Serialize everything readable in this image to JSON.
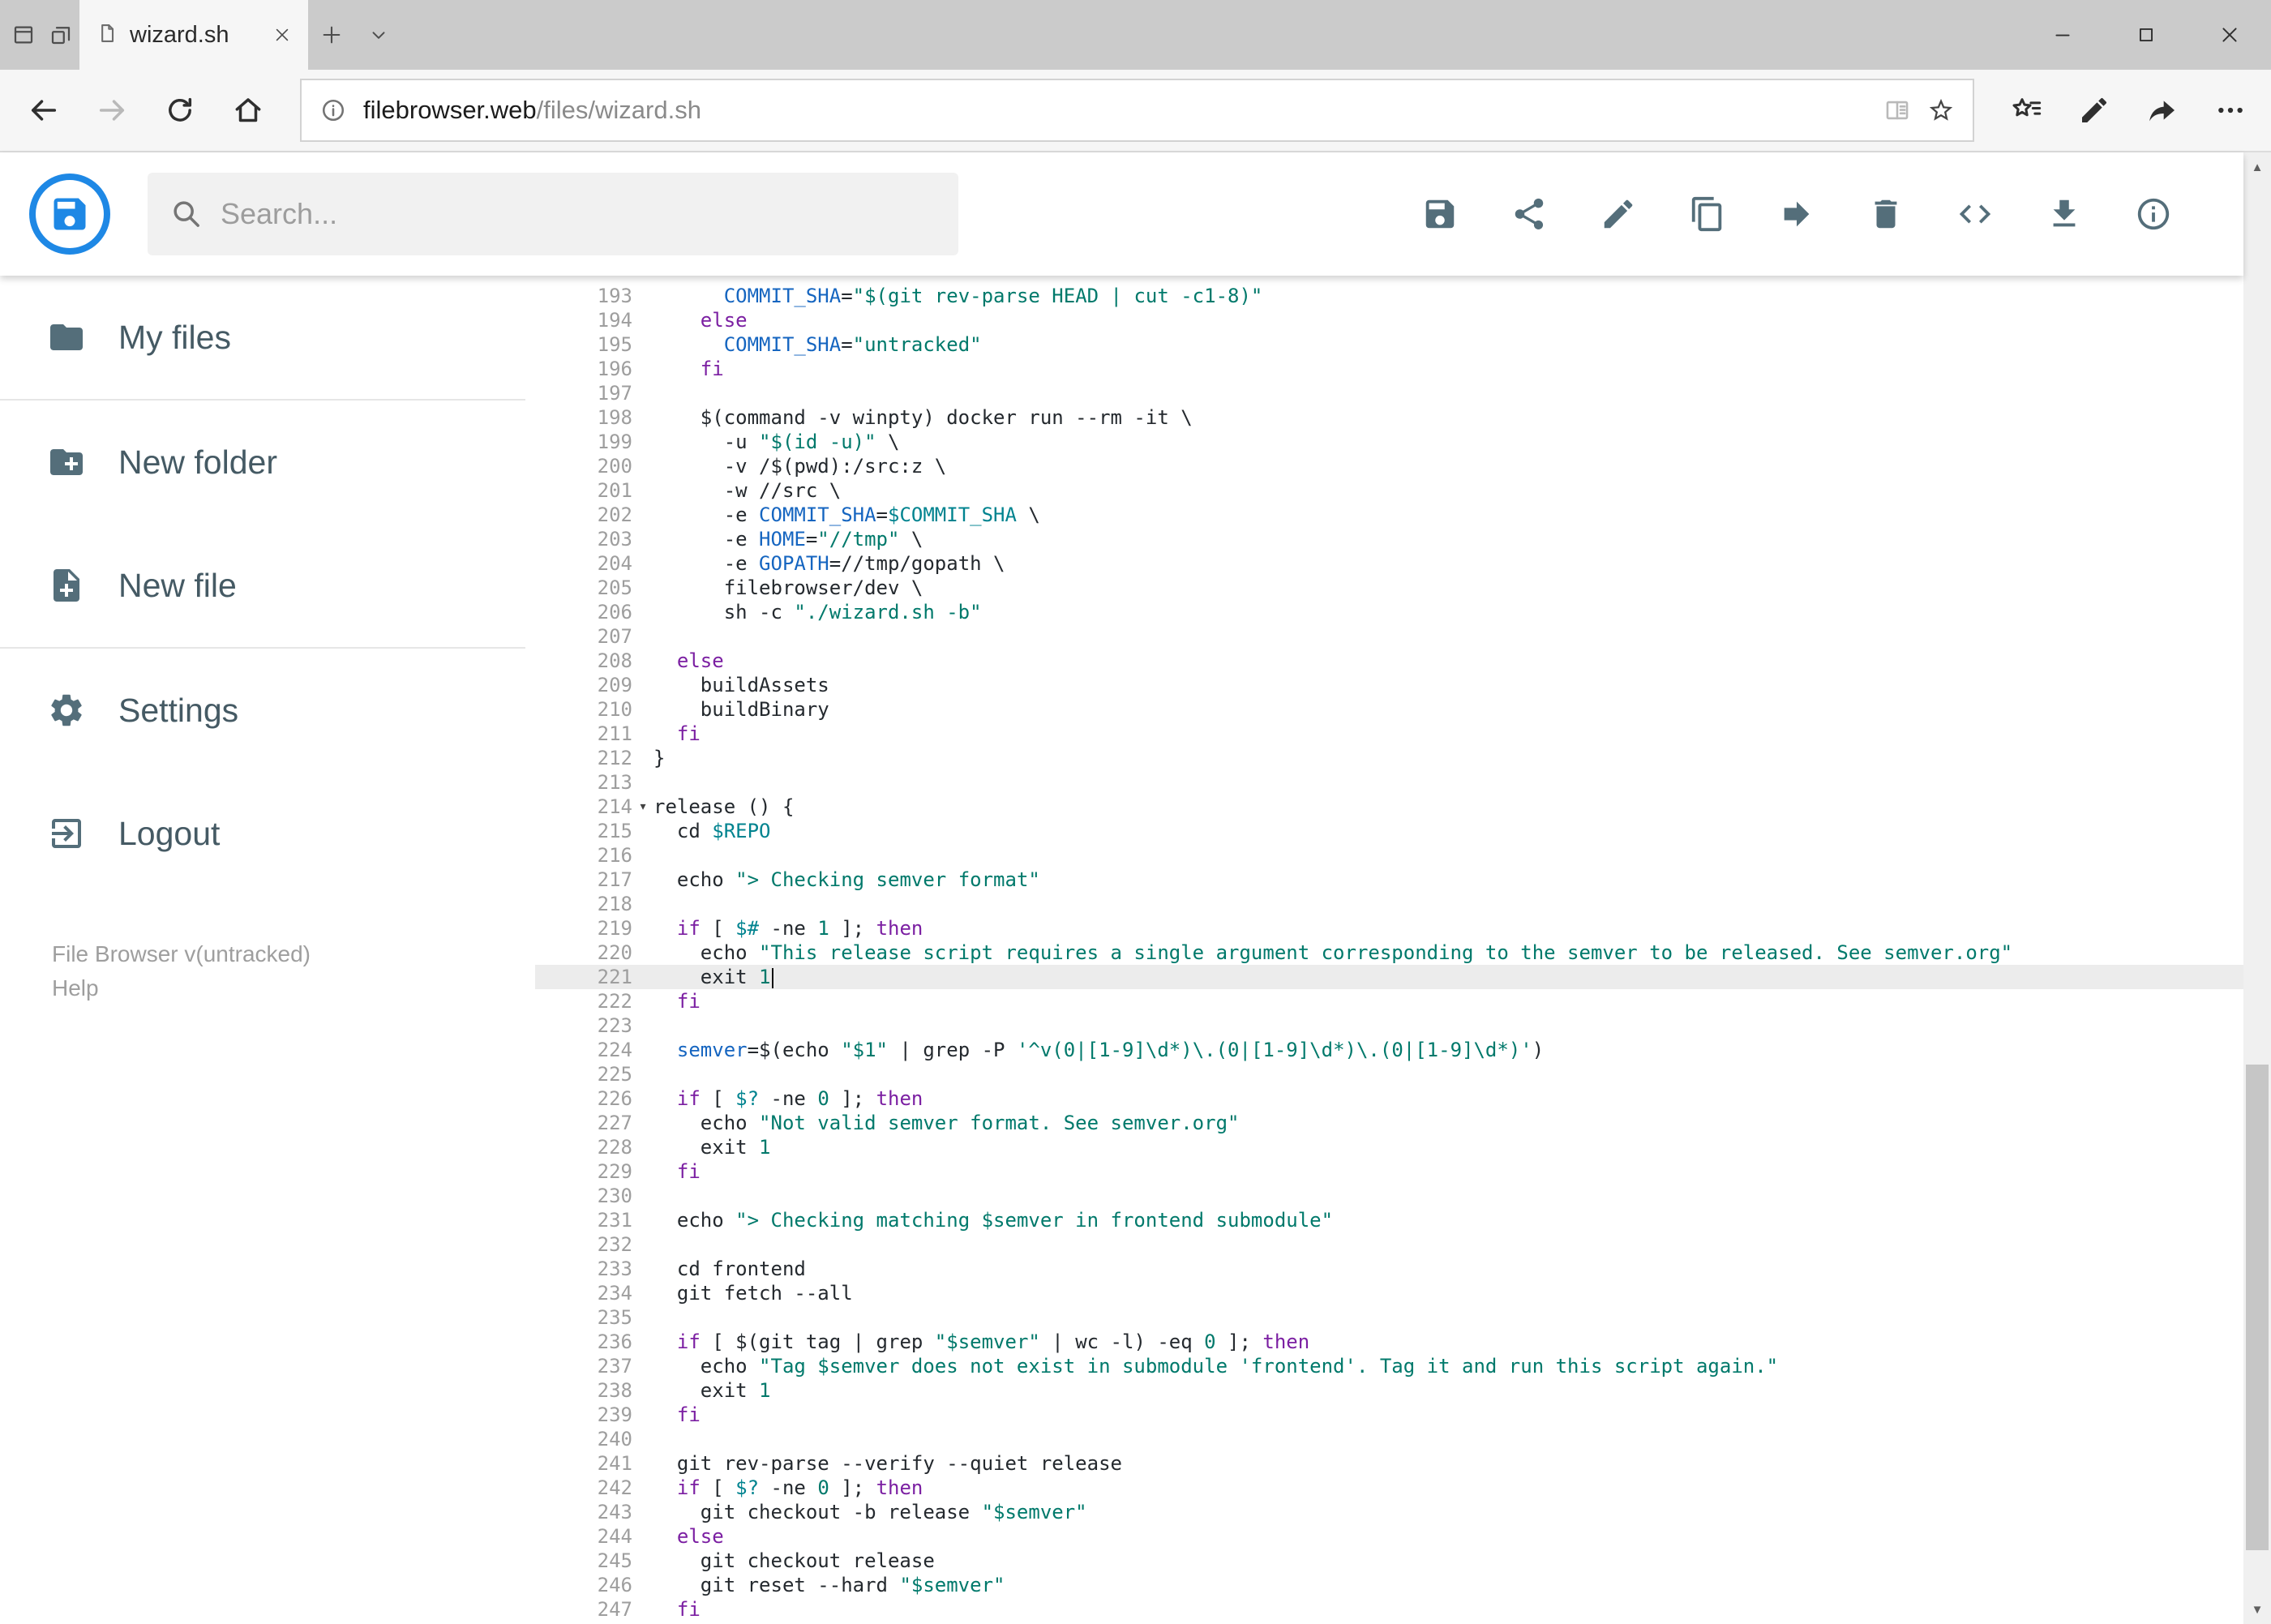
{
  "browser": {
    "tab_title": "wizard.sh",
    "url_host": "filebrowser.web",
    "url_path": "/files/wizard.sh"
  },
  "header": {
    "search_placeholder": "Search...",
    "action_icons": [
      "save",
      "share",
      "rename",
      "copy",
      "move",
      "delete",
      "raw-view",
      "download",
      "info"
    ]
  },
  "sidebar": {
    "items": [
      {
        "label": "My files",
        "icon": "folder-icon"
      },
      {
        "label": "New folder",
        "icon": "new-folder-icon"
      },
      {
        "label": "New file",
        "icon": "new-file-icon"
      },
      {
        "label": "Settings",
        "icon": "settings-icon"
      },
      {
        "label": "Logout",
        "icon": "logout-icon"
      }
    ],
    "footer_version": "File Browser v(untracked)",
    "footer_help": "Help"
  },
  "theme": {
    "brand_blue": "#1e88e5",
    "icon_gray": "#546e7a"
  },
  "editor": {
    "active_line": 221,
    "fold_marker_line": 214,
    "first_line": 193,
    "last_line": 247,
    "lines": [
      {
        "n": 193,
        "text": "      COMMIT_SHA=\"$(git rev-parse HEAD | cut -c1-8)\""
      },
      {
        "n": 194,
        "text": "    else"
      },
      {
        "n": 195,
        "text": "      COMMIT_SHA=\"untracked\""
      },
      {
        "n": 196,
        "text": "    fi"
      },
      {
        "n": 197,
        "text": ""
      },
      {
        "n": 198,
        "text": "    $(command -v winpty) docker run --rm -it \\"
      },
      {
        "n": 199,
        "text": "      -u \"$(id -u)\" \\"
      },
      {
        "n": 200,
        "text": "      -v /$(pwd):/src:z \\"
      },
      {
        "n": 201,
        "text": "      -w //src \\"
      },
      {
        "n": 202,
        "text": "      -e COMMIT_SHA=$COMMIT_SHA \\"
      },
      {
        "n": 203,
        "text": "      -e HOME=\"//tmp\" \\"
      },
      {
        "n": 204,
        "text": "      -e GOPATH=//tmp/gopath \\"
      },
      {
        "n": 205,
        "text": "      filebrowser/dev \\"
      },
      {
        "n": 206,
        "text": "      sh -c \"./wizard.sh -b\""
      },
      {
        "n": 207,
        "text": ""
      },
      {
        "n": 208,
        "text": "  else"
      },
      {
        "n": 209,
        "text": "    buildAssets"
      },
      {
        "n": 210,
        "text": "    buildBinary"
      },
      {
        "n": 211,
        "text": "  fi"
      },
      {
        "n": 212,
        "text": "}"
      },
      {
        "n": 213,
        "text": ""
      },
      {
        "n": 214,
        "text": "release () {"
      },
      {
        "n": 215,
        "text": "  cd $REPO"
      },
      {
        "n": 216,
        "text": ""
      },
      {
        "n": 217,
        "text": "  echo \"> Checking semver format\""
      },
      {
        "n": 218,
        "text": ""
      },
      {
        "n": 219,
        "text": "  if [ $# -ne 1 ]; then"
      },
      {
        "n": 220,
        "text": "    echo \"This release script requires a single argument corresponding to the semver to be released. See semver.org\""
      },
      {
        "n": 221,
        "text": "    exit 1"
      },
      {
        "n": 222,
        "text": "  fi"
      },
      {
        "n": 223,
        "text": ""
      },
      {
        "n": 224,
        "text": "  semver=$(echo \"$1\" | grep -P '^v(0|[1-9]\\d*)\\.(0|[1-9]\\d*)\\.(0|[1-9]\\d*)')"
      },
      {
        "n": 225,
        "text": ""
      },
      {
        "n": 226,
        "text": "  if [ $? -ne 0 ]; then"
      },
      {
        "n": 227,
        "text": "    echo \"Not valid semver format. See semver.org\""
      },
      {
        "n": 228,
        "text": "    exit 1"
      },
      {
        "n": 229,
        "text": "  fi"
      },
      {
        "n": 230,
        "text": ""
      },
      {
        "n": 231,
        "text": "  echo \"> Checking matching $semver in frontend submodule\""
      },
      {
        "n": 232,
        "text": ""
      },
      {
        "n": 233,
        "text": "  cd frontend"
      },
      {
        "n": 234,
        "text": "  git fetch --all"
      },
      {
        "n": 235,
        "text": ""
      },
      {
        "n": 236,
        "text": "  if [ $(git tag | grep \"$semver\" | wc -l) -eq 0 ]; then"
      },
      {
        "n": 237,
        "text": "    echo \"Tag $semver does not exist in submodule 'frontend'. Tag it and run this script again.\""
      },
      {
        "n": 238,
        "text": "    exit 1"
      },
      {
        "n": 239,
        "text": "  fi"
      },
      {
        "n": 240,
        "text": ""
      },
      {
        "n": 241,
        "text": "  git rev-parse --verify --quiet release"
      },
      {
        "n": 242,
        "text": "  if [ $? -ne 0 ]; then"
      },
      {
        "n": 243,
        "text": "    git checkout -b release \"$semver\""
      },
      {
        "n": 244,
        "text": "  else"
      },
      {
        "n": 245,
        "text": "    git checkout release"
      },
      {
        "n": 246,
        "text": "    git reset --hard \"$semver\""
      },
      {
        "n": 247,
        "text": "  fi"
      }
    ]
  }
}
